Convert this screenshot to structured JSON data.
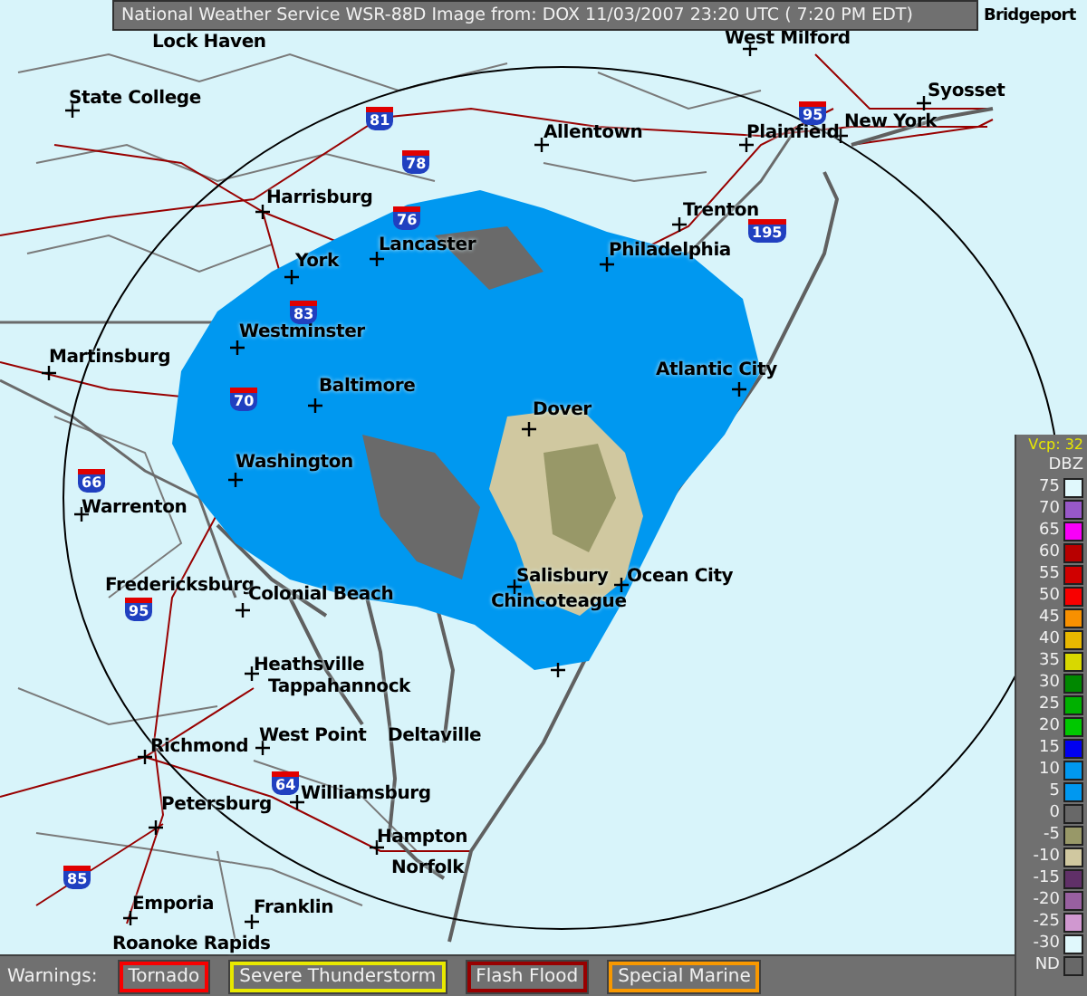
{
  "title_bar": {
    "text": "National Weather Service WSR-88D Image from: DOX 11/03/2007 23:20 UTC ( 7:20 PM EDT)"
  },
  "map": {
    "cities": [
      {
        "name": "Lock Haven"
      },
      {
        "name": "West Milford"
      },
      {
        "name": "Bridgeport"
      },
      {
        "name": "State College"
      },
      {
        "name": "Syosset"
      },
      {
        "name": "Allentown"
      },
      {
        "name": "Plainfield"
      },
      {
        "name": "New York"
      },
      {
        "name": "Harrisburg"
      },
      {
        "name": "Trenton"
      },
      {
        "name": "Lancaster"
      },
      {
        "name": "Philadelphia"
      },
      {
        "name": "York"
      },
      {
        "name": "Westminster"
      },
      {
        "name": "Martinsburg"
      },
      {
        "name": "Atlantic City"
      },
      {
        "name": "Baltimore"
      },
      {
        "name": "Dover"
      },
      {
        "name": "Washington"
      },
      {
        "name": "Warrenton"
      },
      {
        "name": "Fredericksburg"
      },
      {
        "name": "Colonial Beach"
      },
      {
        "name": "Salisbury"
      },
      {
        "name": "Ocean City"
      },
      {
        "name": "Chincoteague"
      },
      {
        "name": "Heathsville"
      },
      {
        "name": "Tappahannock"
      },
      {
        "name": "Richmond"
      },
      {
        "name": "West Point"
      },
      {
        "name": "Deltaville"
      },
      {
        "name": "Williamsburg"
      },
      {
        "name": "Petersburg"
      },
      {
        "name": "Hampton"
      },
      {
        "name": "Norfolk"
      },
      {
        "name": "Emporia"
      },
      {
        "name": "Franklin"
      },
      {
        "name": "Roanoke Rapids"
      }
    ],
    "interstates": [
      {
        "number": "81"
      },
      {
        "number": "78"
      },
      {
        "number": "76"
      },
      {
        "number": "83"
      },
      {
        "number": "70"
      },
      {
        "number": "95"
      },
      {
        "number": "195"
      },
      {
        "number": "66"
      },
      {
        "number": "95"
      },
      {
        "number": "64"
      },
      {
        "number": "85"
      }
    ]
  },
  "legend": {
    "vcp": "Vcp: 32",
    "unit": "DBZ",
    "entries": [
      {
        "label": "75",
        "color": "#e0f8fc"
      },
      {
        "label": "70",
        "color": "#9858c8"
      },
      {
        "label": "65",
        "color": "#f800f8"
      },
      {
        "label": "60",
        "color": "#b80000"
      },
      {
        "label": "55",
        "color": "#d00000"
      },
      {
        "label": "50",
        "color": "#f80000"
      },
      {
        "label": "45",
        "color": "#f89000"
      },
      {
        "label": "40",
        "color": "#e8b800"
      },
      {
        "label": "35",
        "color": "#d8d800"
      },
      {
        "label": "30",
        "color": "#008800"
      },
      {
        "label": "25",
        "color": "#00b000"
      },
      {
        "label": "20",
        "color": "#00c800"
      },
      {
        "label": "15",
        "color": "#0000f0"
      },
      {
        "label": "10",
        "color": "#0098f0"
      },
      {
        "label": "5",
        "color": "#0098f0"
      },
      {
        "label": "0",
        "color": "#686868"
      },
      {
        "label": "-5",
        "color": "#989868"
      },
      {
        "label": "-10",
        "color": "#d0c8a0"
      },
      {
        "label": "-15",
        "color": "#603068"
      },
      {
        "label": "-20",
        "color": "#9860a0"
      },
      {
        "label": "-25",
        "color": "#d098d0"
      },
      {
        "label": "-30",
        "color": "#e0f8fc"
      },
      {
        "label": "ND",
        "color": "#686868"
      }
    ]
  },
  "warnings": {
    "label": "Warnings:",
    "items": [
      {
        "label": "Tornado",
        "color": "#f80000"
      },
      {
        "label": "Severe Thunderstorm",
        "color": "#e8e800"
      },
      {
        "label": "Flash Flood",
        "color": "#980000"
      },
      {
        "label": "Special Marine",
        "color": "#f89800"
      }
    ]
  }
}
